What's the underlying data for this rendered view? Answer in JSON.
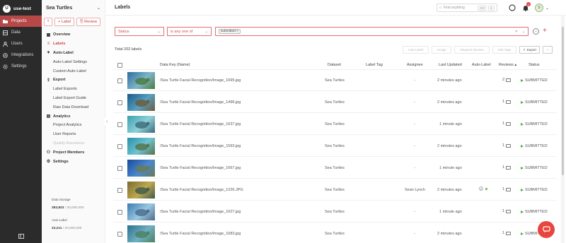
{
  "nav": {
    "org": "use-test",
    "org_initial": "U",
    "items": [
      {
        "label": "Projects",
        "icon": "folder-icon"
      },
      {
        "label": "Data",
        "icon": "data-icon"
      },
      {
        "label": "Users",
        "icon": "users-icon"
      },
      {
        "label": "Integrations",
        "icon": "integrations-icon"
      },
      {
        "label": "Settings",
        "icon": "gear-icon"
      }
    ]
  },
  "project": {
    "name": "Sea Turtles",
    "label_button": "Label",
    "review_button": "Review",
    "menu": [
      {
        "label": "Overview",
        "type": "head",
        "icon": "overview-icon"
      },
      {
        "label": "Labels",
        "type": "head-selected",
        "icon": "labels-icon"
      },
      {
        "label": "Auto-Label",
        "type": "head",
        "icon": "auto-label-icon"
      },
      {
        "label": "Auto-Label Settings",
        "type": "sub"
      },
      {
        "label": "Custom Auto-Label",
        "type": "sub"
      },
      {
        "label": "Export",
        "type": "head",
        "icon": "export-icon"
      },
      {
        "label": "Label Exports",
        "type": "sub"
      },
      {
        "label": "Label Export Guide",
        "type": "sub"
      },
      {
        "label": "Raw Data Download",
        "type": "sub"
      },
      {
        "label": "Analytics",
        "type": "head",
        "icon": "analytics-icon"
      },
      {
        "label": "Project Analytics",
        "type": "sub"
      },
      {
        "label": "User Reports",
        "type": "sub"
      },
      {
        "label": "Quality Assurance",
        "type": "sub-disabled"
      },
      {
        "label": "Project Members",
        "type": "head",
        "icon": "members-icon"
      },
      {
        "label": "Settings",
        "type": "head",
        "icon": "settings-icon"
      }
    ],
    "data_storage_label": "Data Storage",
    "data_storage_used": "283,823",
    "data_storage_total": "/ 20,000,000",
    "auto_label_label": "Auto-Label",
    "auto_label_used": "23,211",
    "auto_label_total": "/ 20,000,000"
  },
  "header": {
    "title": "Labels",
    "search_placeholder": "Find anything",
    "kbd1": "Ctrl",
    "kbd2": "K",
    "notification_count": "1",
    "avatar_initial": "S"
  },
  "filter": {
    "field": "Status",
    "operator": "is any one of",
    "chip": "submitted"
  },
  "toolbar": {
    "total": "Total 202 labels",
    "buttons": [
      "Auto-Label",
      "Assign",
      "Request Review",
      "Edit Tags",
      "Export"
    ]
  },
  "table": {
    "headers": [
      "Data Key (Name)",
      "Dataset",
      "Label Tag",
      "Assignee",
      "Last Updated",
      "Auto-Label",
      "Reviews",
      "Status"
    ],
    "rows": [
      {
        "key": "/Sea Turtle Facial Recognition/Image_1695.jpg",
        "dataset": "Sea Turtles",
        "assignee": "-",
        "updated": "2 minutes ago",
        "reviews": "2",
        "status": "SUBMITTED"
      },
      {
        "key": "/Sea Turtle Facial Recognition/Image_1496.jpg",
        "dataset": "Sea Turtles",
        "assignee": "-",
        "updated": "2 minutes ago",
        "reviews": "1",
        "status": "SUBMITTED"
      },
      {
        "key": "/Sea Turtle Facial Recognition/Image_1637.jpg",
        "dataset": "Sea Turtles",
        "assignee": "-",
        "updated": "1 minute ago",
        "reviews": "1",
        "status": "SUBMITTED"
      },
      {
        "key": "/Sea Turtle Facial Recognition/Image_1593.jpg",
        "dataset": "Sea Turtles",
        "assignee": "-",
        "updated": "2 minutes ago",
        "reviews": "1",
        "status": "SUBMITTED"
      },
      {
        "key": "/Sea Turtle Facial Recognition/Image_1667.jpg",
        "dataset": "Sea Turtles",
        "assignee": "-",
        "updated": "1 minute ago",
        "reviews": "1",
        "status": "SUBMITTED"
      },
      {
        "key": "/Sea Turtle Facial Recognition/Image_1226.JPG",
        "dataset": "Sea Turtles",
        "assignee": "Sean Lynch",
        "updated": "2 minutes ago",
        "reviews": "1",
        "status": "SUBMITTED"
      },
      {
        "key": "/Sea Turtle Facial Recognition/Image_1627.jpg",
        "dataset": "Sea Turtles",
        "assignee": "-",
        "updated": "1 minute ago",
        "reviews": "1",
        "status": "SUBMITTED"
      },
      {
        "key": "/Sea Turtle Facial Recognition/Image_1683.jpg",
        "dataset": "Sea Turtles",
        "assignee": "-",
        "updated": "2 minutes ago",
        "reviews": "1",
        "status": "SUBMITTED"
      }
    ]
  },
  "colors": {
    "accent": "#d04848",
    "nav_bg": "#2b2b2b",
    "status_green": "#3bb34a"
  }
}
